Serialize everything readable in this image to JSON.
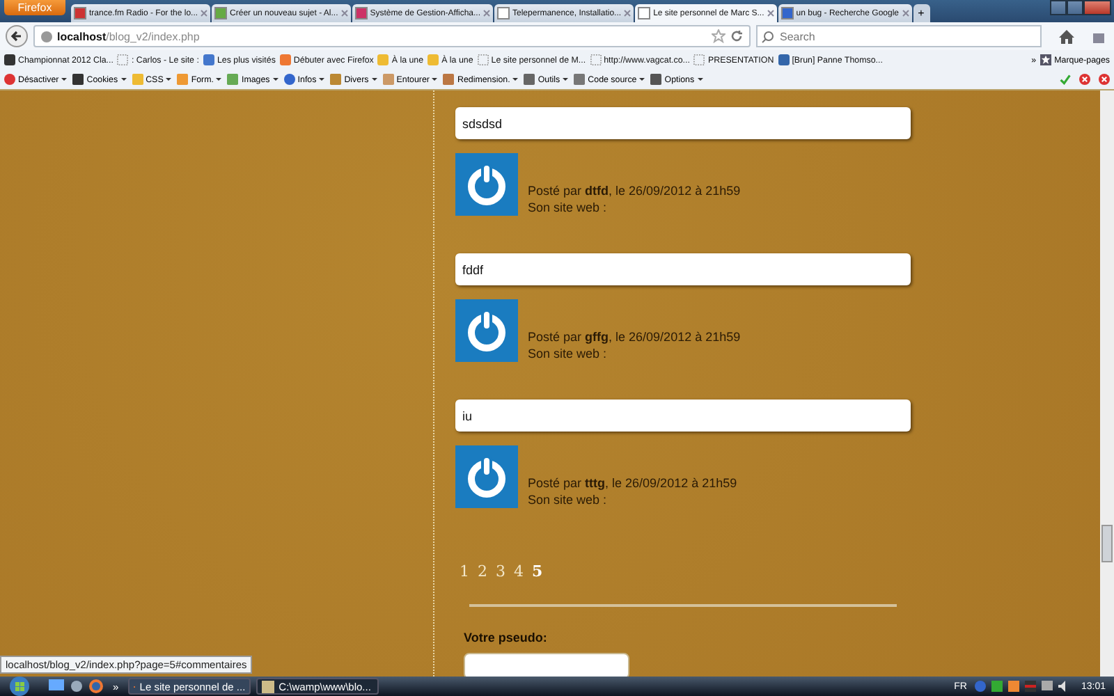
{
  "browser": {
    "menu_button": "Firefox",
    "tabs": [
      {
        "title": "trance.fm Radio - For the lo...",
        "selected": false
      },
      {
        "title": "Créer un nouveau sujet - Al...",
        "selected": false
      },
      {
        "title": "Système de Gestion-Afficha...",
        "selected": false
      },
      {
        "title": "Telepermanence, Installatio...",
        "selected": false
      },
      {
        "title": "Le site personnel de Marc S...",
        "selected": true
      },
      {
        "title": "un bug - Recherche Google",
        "selected": false
      }
    ],
    "new_tab": "+",
    "address_host": "localhost",
    "address_path": "/blog_v2/index.php",
    "search_placeholder": "Search",
    "bookmarks": [
      "Championnat 2012 Cla...",
      ": Carlos - Le site :",
      "Les plus visités",
      "Débuter avec Firefox",
      "À la une",
      "À la une",
      "Le site personnel de M...",
      "http://www.vagcat.co...",
      "PRESENTATION",
      "[Brun] Panne Thomso..."
    ],
    "more_bookmarks": "»",
    "bookmarks_menu": "Marque-pages",
    "toolbar": [
      "Désactiver",
      "Cookies",
      "CSS",
      "Form.",
      "Images",
      "Infos",
      "Divers",
      "Entourer",
      "Redimension.",
      "Outils",
      "Code source",
      "Options"
    ]
  },
  "comments": [
    {
      "text": "sdsdsd",
      "meta": "Posté par **dtfd**, le 26/09/2012 à 21h59",
      "website_label": "Son site web :"
    },
    {
      "text": "fddf",
      "meta": "Posté par **gffg**, le 26/09/2012 à 21h59",
      "website_label": "Son site web :"
    },
    {
      "text": "iu",
      "meta": "Posté par **tttg**, le 26/09/2012 à 21h59",
      "website_label": "Son site web :"
    }
  ],
  "pagination": [
    {
      "label": "1",
      "selected": false
    },
    {
      "label": "2",
      "selected": false
    },
    {
      "label": "3",
      "selected": false
    },
    {
      "label": "4",
      "selected": false
    },
    {
      "label": "5",
      "selected": true
    }
  ],
  "form": {
    "pseudo_label": "Votre pseudo:"
  },
  "status_url": "localhost/blog_v2/index.php?page=5#commentaires",
  "taskbar": {
    "more": "»",
    "windows": [
      {
        "title": "Le site personnel de ...",
        "selected": true
      },
      {
        "title": "C:\\wamp\\www\\blo...",
        "selected": false
      }
    ],
    "language": "FR",
    "clock": "13:01"
  }
}
